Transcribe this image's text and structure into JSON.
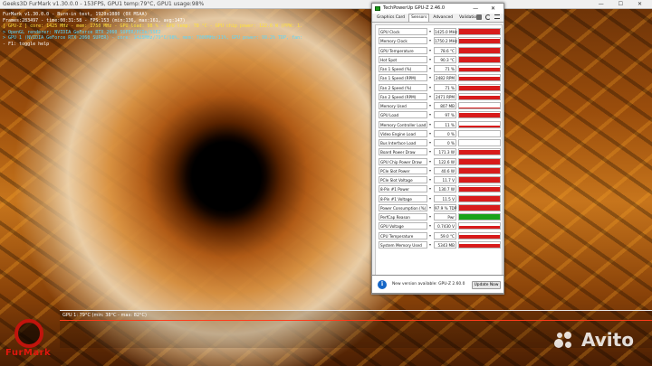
{
  "furmark": {
    "window_title": "Geeks3D FurMark v1.30.0.0 - 153FPS, GPU1 temp:79°C, GPU1 usage:98%",
    "window_controls": "— ☐ ✕",
    "overlay_lines": [
      {
        "text": "FurMark v1.30.0.0 - Burn-in test, 1920x1080 (0X MSAA)",
        "color": "white"
      },
      {
        "text": "Frames:283497 - time:00:31:58 - FPS:153 (min:136, max:161, avg:147)",
        "color": "white"
      },
      {
        "text": "[ GPU-Z ] core: 1425 MHz - mem: 1750 MHz - GPU load: 98 % - GPU temp: 78 °C - GPU chip power: 122.6 W (PPW: 1.245) - Board power: 173.7 W (PPW: 0.881) - GPU voltage: 0.743 V",
        "color": "yellow"
      },
      {
        "text": "> OpenGL renderer: NVIDIA GeForce RTX 2060 SUPER/PCIe/SSE2",
        "color": "cyan"
      },
      {
        "text": "> GPU 1 (NVIDIA GeForce RTX 2060 SUPER) - core: 1425MHz/79°C/98%, mem: 7000MHz/11%, GPU power: 99.2% TDP, fan: 71%, limits:[power:1, temp:0, volt:0, OV:0]",
        "color": "cyan"
      },
      {
        "text": "- F1: toggle help",
        "color": "white"
      }
    ],
    "graph_label": "GPU 1: 79°C (min: 38°C - max: 82°C)",
    "logo_text": "FurMark",
    "watermark_text": "Avito"
  },
  "gpuz": {
    "title": "TechPowerUp GPU-Z 2.46.0",
    "window_controls": "— ✕",
    "tabs": [
      "Graphics Card",
      "Sensors",
      "Advanced",
      "Validation"
    ],
    "active_tab": "Sensors",
    "sensors": [
      {
        "label": "GPU Clock",
        "value": "1425.0 MHz",
        "level": 0.95,
        "color": "red"
      },
      {
        "label": "Memory Clock",
        "value": "1750.2 MHz",
        "level": 0.95,
        "color": "red"
      },
      {
        "label": "GPU Temperature",
        "value": "78.6 °C",
        "level": 0.85,
        "color": "red"
      },
      {
        "label": "Hot Spot",
        "value": "90.3 °C",
        "level": 0.9,
        "color": "red"
      },
      {
        "label": "Fan 1 Speed (%)",
        "value": "71 %",
        "level": 0.7,
        "color": "red"
      },
      {
        "label": "Fan 1 Speed (RPM)",
        "value": "2482 RPM",
        "level": 0.7,
        "color": "red"
      },
      {
        "label": "Fan 2 Speed (%)",
        "value": "71 %",
        "level": 0.7,
        "color": "red"
      },
      {
        "label": "Fan 2 Speed (RPM)",
        "value": "2471 RPM",
        "level": 0.7,
        "color": "red"
      },
      {
        "label": "Memory Used",
        "value": "807 MB",
        "level": 0.1,
        "color": "red"
      },
      {
        "label": "GPU Load",
        "value": "97 %",
        "level": 0.85,
        "color": "red"
      },
      {
        "label": "Memory Controller Load",
        "value": "11 %",
        "level": 0.3,
        "color": "red"
      },
      {
        "label": "Video Engine Load",
        "value": "0 %",
        "level": 0.0,
        "color": "red"
      },
      {
        "label": "Bus Interface Load",
        "value": "0 %",
        "level": 0.0,
        "color": "red"
      },
      {
        "label": "Board Power Draw",
        "value": "171.3 W",
        "level": 0.95,
        "color": "red"
      },
      {
        "label": "GPU Chip Power Draw",
        "value": "122.6 W",
        "level": 0.95,
        "color": "red"
      },
      {
        "label": "PCIe Slot Power",
        "value": "40.6 W",
        "level": 0.9,
        "color": "red"
      },
      {
        "label": "PCIe Slot Voltage",
        "value": "11.7 V",
        "level": 0.95,
        "color": "red"
      },
      {
        "label": "8-Pin #1 Power",
        "value": "130.7 W",
        "level": 0.95,
        "color": "red"
      },
      {
        "label": "8-Pin #1 Voltage",
        "value": "11.5 V",
        "level": 0.95,
        "color": "red"
      },
      {
        "label": "Power Consumption (%)",
        "value": "97.9 % TDP",
        "level": 0.95,
        "color": "red"
      },
      {
        "label": "PerfCap Reason",
        "value": "Pwr",
        "level": 1.0,
        "color": "green"
      },
      {
        "label": "GPU Voltage",
        "value": "0.7430 V",
        "level": 0.6,
        "color": "red"
      },
      {
        "label": "CPU Temperature",
        "value": "59.0 °C",
        "level": 0.6,
        "color": "red"
      },
      {
        "label": "System Memory Used",
        "value": "5343 MB",
        "level": 0.6,
        "color": "red"
      }
    ],
    "log_to_file_label": "Log to file",
    "reset_label": "Reset",
    "gpu_select_value": "NVIDIA GeForce RTX 2060 SUPER",
    "close_label": "Close",
    "update_message": "New version available: GPU-Z 2.60.0",
    "update_button_label": "Update Now"
  },
  "colors": {
    "graph_red": "#d81b1b",
    "graph_green": "#19a319",
    "info_blue": "#1666c6",
    "furmark_red": "#e2170d"
  }
}
